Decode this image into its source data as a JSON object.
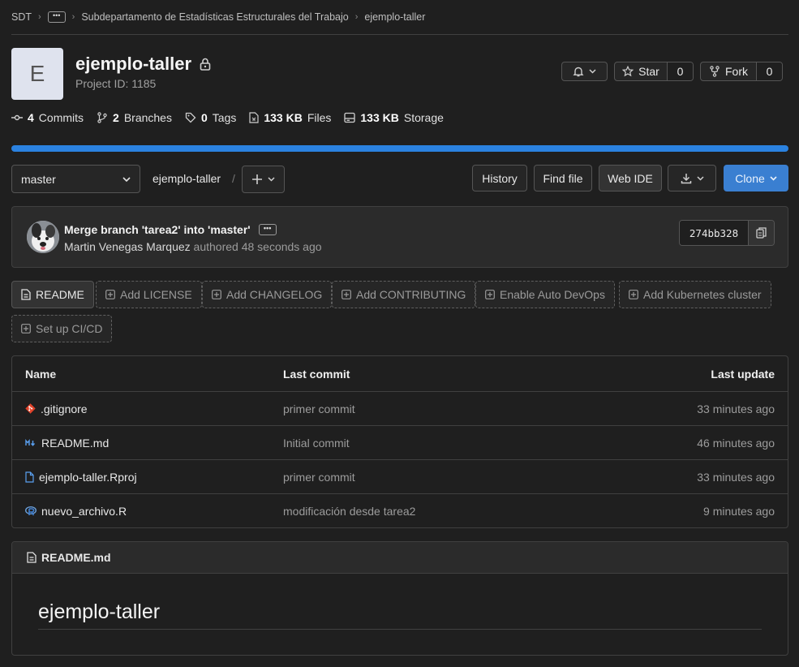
{
  "breadcrumb": {
    "root": "SDT",
    "more": "•••",
    "group": "Subdepartamento de Estadísticas Estructurales del Trabajo",
    "project": "ejemplo-taller"
  },
  "project": {
    "avatar_letter": "E",
    "name": "ejemplo-taller",
    "id_label": "Project ID: 1185",
    "visibility_icon": "lock-icon"
  },
  "actions": {
    "star_label": "Star",
    "star_count": "0",
    "fork_label": "Fork",
    "fork_count": "0"
  },
  "stats": [
    {
      "count": "4",
      "label": "Commits",
      "icon": "commit-icon"
    },
    {
      "count": "2",
      "label": "Branches",
      "icon": "branch-icon"
    },
    {
      "count": "0",
      "label": "Tags",
      "icon": "tag-icon"
    },
    {
      "count": "133 KB",
      "label": "Files",
      "icon": "file-icon"
    },
    {
      "count": "133 KB",
      "label": "Storage",
      "icon": "storage-icon"
    }
  ],
  "toolbar": {
    "branch": "master",
    "path_root": "ejemplo-taller",
    "path_sep": "/",
    "history": "History",
    "find_file": "Find file",
    "web_ide": "Web IDE",
    "clone": "Clone"
  },
  "last_commit": {
    "title": "Merge branch 'tarea2' into 'master'",
    "more": "•••",
    "author": "Martin Venegas Marquez",
    "time": "authored 48 seconds ago",
    "sha": "274bb328"
  },
  "quick_actions": [
    {
      "label": "README",
      "style": "solid"
    },
    {
      "label": "Add LICENSE",
      "style": "dashed"
    },
    {
      "label": "Add CHANGELOG",
      "style": "dashed"
    },
    {
      "label": "Add CONTRIBUTING",
      "style": "dashed"
    },
    {
      "label": "Enable Auto DevOps",
      "style": "dashed"
    },
    {
      "label": "Add Kubernetes cluster",
      "style": "dashed"
    },
    {
      "label": "Set up CI/CD",
      "style": "dashed"
    }
  ],
  "files": {
    "headers": {
      "name": "Name",
      "last_commit": "Last commit",
      "last_update": "Last update"
    },
    "rows": [
      {
        "name": ".gitignore",
        "commit": "primer commit",
        "updated": "33 minutes ago",
        "icon": "git-icon"
      },
      {
        "name": "README.md",
        "commit": "Initial commit",
        "updated": "46 minutes ago",
        "icon": "markdown-icon"
      },
      {
        "name": "ejemplo-taller.Rproj",
        "commit": "primer commit",
        "updated": "33 minutes ago",
        "icon": "file-icon"
      },
      {
        "name": "nuevo_archivo.R",
        "commit": "modificación desde tarea2",
        "updated": "9 minutes ago",
        "icon": "r-language-icon"
      }
    ]
  },
  "readme": {
    "filename": "README.md",
    "heading": "ejemplo-taller"
  },
  "colors": {
    "background": "#1f1f1f",
    "panel": "#2b2b2b",
    "accent": "#2b82e0",
    "clone_button": "#3a7fd1",
    "git_icon": "#e2432a",
    "markdown_icon": "#5aa0f0"
  }
}
